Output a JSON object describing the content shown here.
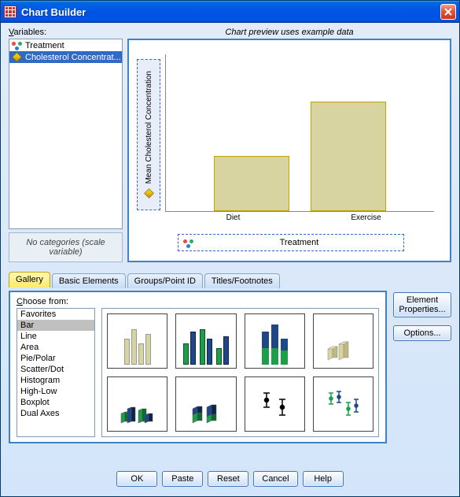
{
  "window": {
    "title": "Chart Builder"
  },
  "variables": {
    "label": "Variables:",
    "items": [
      {
        "name": "Treatment"
      },
      {
        "name": "Cholesterol Concentrat..."
      }
    ],
    "no_categories": "No categories (scale variable)"
  },
  "preview": {
    "label": "Chart preview uses example data",
    "y_axis_label": "Mean Cholesterol Concentration",
    "x_axis_label": "Treatment",
    "categories": [
      "Diet",
      "Exercise"
    ]
  },
  "tabs": {
    "items": [
      "Gallery",
      "Basic Elements",
      "Groups/Point ID",
      "Titles/Footnotes"
    ],
    "active": 0
  },
  "gallery": {
    "choose_label": "Choose from:",
    "types": [
      "Favorites",
      "Bar",
      "Line",
      "Area",
      "Pie/Polar",
      "Scatter/Dot",
      "Histogram",
      "High-Low",
      "Boxplot",
      "Dual Axes"
    ],
    "selected": 1
  },
  "side_buttons": {
    "element_properties": "Element Properties...",
    "options": "Options..."
  },
  "buttons": {
    "ok": "OK",
    "paste": "Paste",
    "reset": "Reset",
    "cancel": "Cancel",
    "help": "Help"
  },
  "chart_data": {
    "type": "bar",
    "title": "",
    "xlabel": "Treatment",
    "ylabel": "Mean Cholesterol Concentration",
    "categories": [
      "Diet",
      "Exercise"
    ],
    "values": [
      35,
      70
    ],
    "ylim": [
      0,
      100
    ]
  }
}
